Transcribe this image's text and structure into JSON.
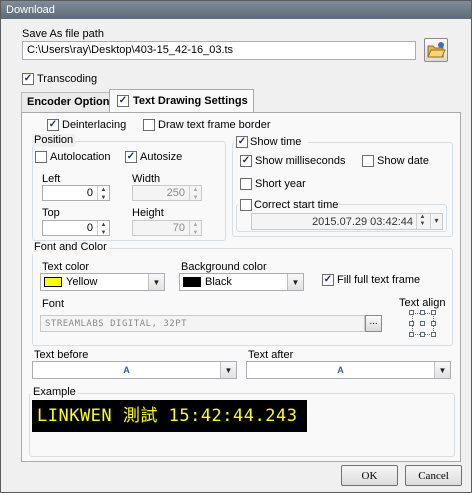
{
  "window": {
    "title": "Download"
  },
  "save": {
    "label": "Save As file path",
    "path": "C:\\Users\\ray\\Desktop\\403-15_42-16_03.ts",
    "folder_icon": "folder-open-icon"
  },
  "transcoding": {
    "label": "Transcoding",
    "checked": true
  },
  "tabs": [
    {
      "label": "Encoder Options",
      "active": false
    },
    {
      "label": "Text Drawing Settings",
      "active": true,
      "checked": true
    }
  ],
  "options": {
    "deinterlacing": {
      "label": "Deinterlacing",
      "checked": true
    },
    "draw_border": {
      "label": "Draw text frame border",
      "checked": false
    }
  },
  "position": {
    "title": "Position",
    "autolocation": {
      "label": "Autolocation",
      "checked": false
    },
    "autosize": {
      "label": "Autosize",
      "checked": true
    },
    "left": {
      "label": "Left",
      "value": "0"
    },
    "width": {
      "label": "Width",
      "value": "250"
    },
    "top": {
      "label": "Top",
      "value": "0"
    },
    "height": {
      "label": "Height",
      "value": "70"
    }
  },
  "time": {
    "show_time": {
      "label": "Show time",
      "checked": true
    },
    "milliseconds": {
      "label": "Show milliseconds",
      "checked": true
    },
    "show_date": {
      "label": "Show date",
      "checked": false
    },
    "short_year": {
      "label": "Short year",
      "checked": false
    },
    "correct_start": {
      "label": "Correct start time",
      "checked": false
    },
    "start_value": "2015.07.29 03:42:44"
  },
  "font_color": {
    "title": "Font and Color",
    "text_color": {
      "label": "Text color",
      "value": "Yellow",
      "swatch": "#ffff00"
    },
    "bg_color": {
      "label": "Background color",
      "value": "Black",
      "swatch": "#000000"
    },
    "fill_frame": {
      "label": "Fill full text frame",
      "checked": true
    },
    "font": {
      "label": "Font",
      "value": "STREAMLABS DIGITAL, 32PT",
      "browse": "..."
    },
    "text_align": {
      "label": "Text align"
    }
  },
  "text_before": {
    "label": "Text before",
    "value": ""
  },
  "text_after": {
    "label": "Text after",
    "value": ""
  },
  "example": {
    "label": "Example",
    "text": "LINKWEN 測試 15:42:44.243",
    "fg": "#ffff00",
    "bg": "#000000"
  },
  "buttons": {
    "ok": "OK",
    "cancel": "Cancel"
  }
}
